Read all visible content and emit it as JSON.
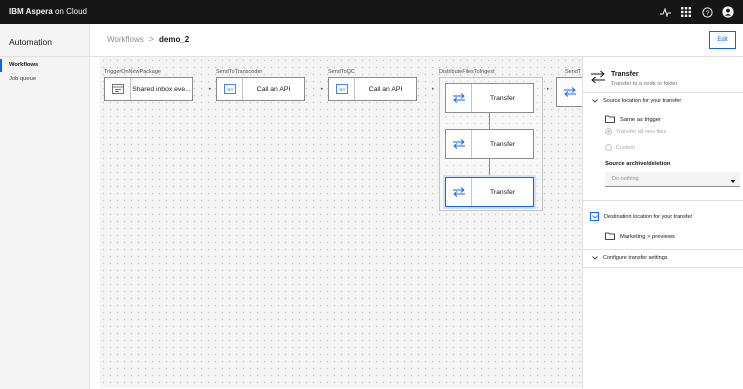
{
  "topbar": {
    "brand_strong": "IBM Aspera",
    "brand_rest": "on Cloud",
    "icons": [
      "activity-icon",
      "app-switcher-icon",
      "help-icon",
      "user-avatar-icon"
    ]
  },
  "sidebar": {
    "title": "Automation",
    "items": [
      {
        "label": "Workflows",
        "active": true
      },
      {
        "label": "Job queue",
        "active": false
      }
    ]
  },
  "header": {
    "breadcrumb_link": "Workflows",
    "breadcrumb_sep": ">",
    "breadcrumb_current": "demo_2",
    "edit_label": "Edit"
  },
  "canvas": {
    "steps": [
      {
        "label": "TriggerOnNewPackage",
        "node": "Shared inbox eve...",
        "icon": "package-icon"
      },
      {
        "label": "SendToTranscoder",
        "node": "Call an API",
        "icon": "api-icon"
      },
      {
        "label": "SendToQC",
        "node": "Call an API",
        "icon": "api-icon"
      },
      {
        "label": "DistributeFilesToIngest",
        "nodes": [
          "Transfer",
          "Transfer",
          "Transfer"
        ],
        "icon": "transfer-icon"
      },
      {
        "label": "SendT",
        "icon": "transfer-icon"
      }
    ]
  },
  "panel": {
    "title": "Transfer",
    "subtitle": "Transfer to a node or folder",
    "source_section": "Source location for your transfer",
    "source_folder": "Same as trigger",
    "radio_transfer_all": "Transfer all new files",
    "radio_custom": "Custom",
    "archive_label": "Source archive/deletion",
    "archive_value": "Do nothing",
    "dest_section": "Destination location for your transfer",
    "dest_folder": "Marketing > previews",
    "config_section": "Configure transfer settings"
  },
  "colors": {
    "accent": "#0f62fe",
    "topbar": "#161616",
    "canvas_bg": "#f4f4f4"
  }
}
